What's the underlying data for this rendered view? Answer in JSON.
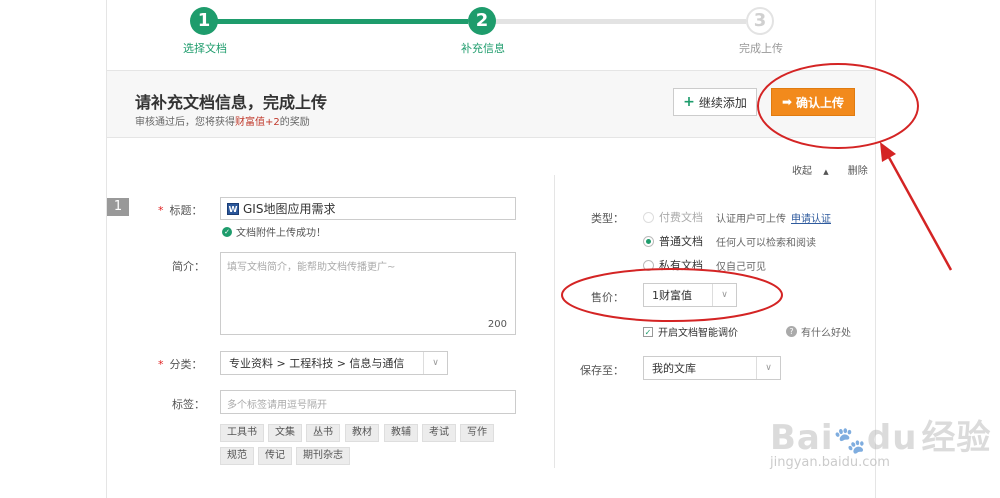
{
  "steps": [
    {
      "num": "1",
      "label": "选择文档"
    },
    {
      "num": "2",
      "label": "补充信息"
    },
    {
      "num": "3",
      "label": "完成上传"
    }
  ],
  "header": {
    "title": "请补充文档信息，完成上传",
    "subtitle_prefix": "审核通过后，您将获得",
    "subtitle_highlight": "财富值+2",
    "subtitle_suffix": "的奖励",
    "add_button": "继续添加",
    "upload_button": "确认上传"
  },
  "doc": {
    "index": "1",
    "collapse": "收起",
    "delete": "删除",
    "title_label": "标题：",
    "title_value": "GIS地图应用需求",
    "upload_ok": "文档附件上传成功！",
    "desc_label": "简介：",
    "desc_placeholder": "填写文档简介，能帮助文档传播更广~",
    "desc_count": "200",
    "category_label": "分类：",
    "category_value": "专业资料 > 工程科技 > 信息与通信",
    "tags_label": "标签：",
    "tags_placeholder": "多个标签请用逗号隔开",
    "tags": [
      "工具书",
      "文集",
      "丛书",
      "教材",
      "教辅",
      "考试",
      "写作",
      "规范",
      "传记",
      "期刊杂志"
    ]
  },
  "settings": {
    "type_label": "类型：",
    "types": [
      {
        "name": "付费文档",
        "desc": "认证用户可上传",
        "link": "申请认证"
      },
      {
        "name": "普通文档",
        "desc": "任何人可以检索和阅读"
      },
      {
        "name": "私有文档",
        "desc": "仅自己可见"
      }
    ],
    "price_label": "售价：",
    "price_value": "1财富值",
    "smart_price": "开启文档智能调价",
    "help": "有什么好处",
    "save_label": "保存至：",
    "save_value": "我的文库"
  },
  "watermark": {
    "brand": "Bai",
    "brand2": "du",
    "suffix": "经验",
    "url": "jingyan.baidu.com"
  }
}
